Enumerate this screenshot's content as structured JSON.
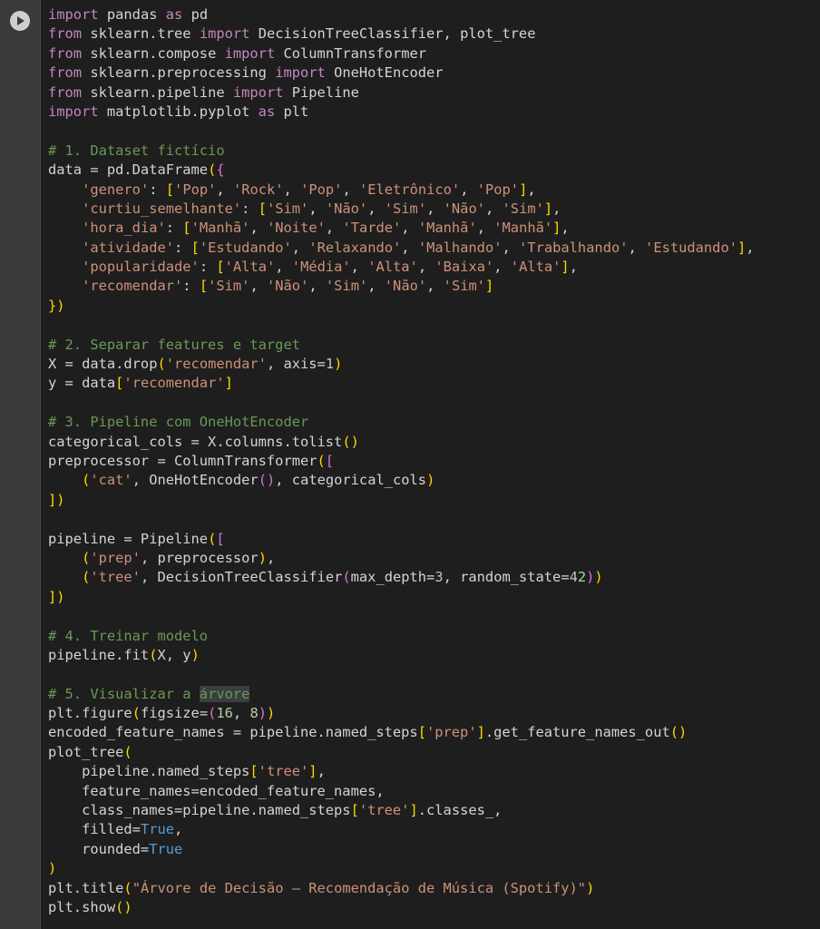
{
  "run_button": {
    "icon": "play-icon"
  },
  "lines": [
    "import pandas as pd",
    "from sklearn.tree import DecisionTreeClassifier, plot_tree",
    "from sklearn.compose import ColumnTransformer",
    "from sklearn.preprocessing import OneHotEncoder",
    "from sklearn.pipeline import Pipeline",
    "import matplotlib.pyplot as plt",
    "",
    "# 1. Dataset fictício",
    "data = pd.DataFrame({",
    "    'genero': ['Pop', 'Rock', 'Pop', 'Eletrônico', 'Pop'],",
    "    'curtiu_semelhante': ['Sim', 'Não', 'Sim', 'Não', 'Sim'],",
    "    'hora_dia': ['Manhã', 'Noite', 'Tarde', 'Manhã', 'Manhã'],",
    "    'atividade': ['Estudando', 'Relaxando', 'Malhando', 'Trabalhando', 'Estudando'],",
    "    'popularidade': ['Alta', 'Média', 'Alta', 'Baixa', 'Alta'],",
    "    'recomendar': ['Sim', 'Não', 'Sim', 'Não', 'Sim']",
    "})",
    "",
    "# 2. Separar features e target",
    "X = data.drop('recomendar', axis=1)",
    "y = data['recomendar']",
    "",
    "# 3. Pipeline com OneHotEncoder",
    "categorical_cols = X.columns.tolist()",
    "preprocessor = ColumnTransformer([",
    "    ('cat', OneHotEncoder(), categorical_cols)",
    "])",
    "",
    "pipeline = Pipeline([",
    "    ('prep', preprocessor),",
    "    ('tree', DecisionTreeClassifier(max_depth=3, random_state=42))",
    "])",
    "",
    "# 4. Treinar modelo",
    "pipeline.fit(X, y)",
    "",
    "# 5. Visualizar a árvore",
    "plt.figure(figsize=(16, 8))",
    "encoded_feature_names = pipeline.named_steps['prep'].get_feature_names_out()",
    "plot_tree(",
    "    pipeline.named_steps['tree'],",
    "    feature_names=encoded_feature_names,",
    "    class_names=pipeline.named_steps['tree'].classes_,",
    "    filled=True,",
    "    rounded=True",
    ")",
    "plt.title(\"Árvore de Decisão – Recomendação de Música (Spotify)\")",
    "plt.show()"
  ]
}
